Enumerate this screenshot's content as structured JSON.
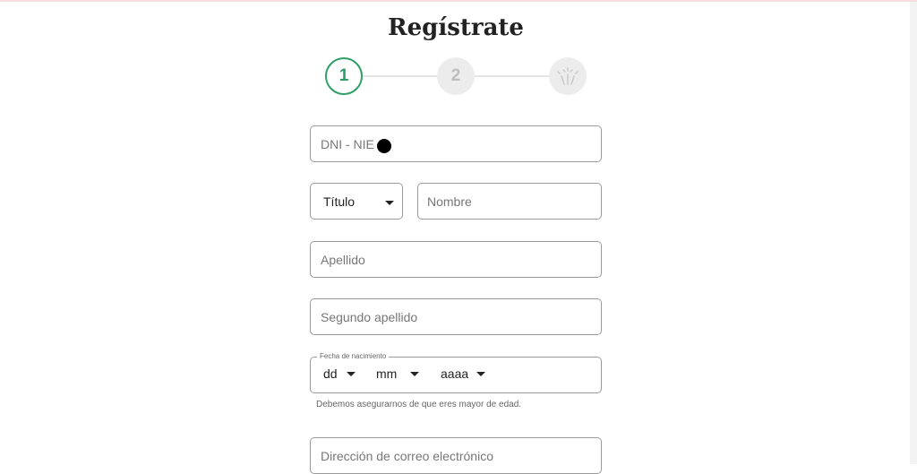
{
  "page": {
    "title": "Regístrate"
  },
  "stepper": {
    "steps": [
      {
        "label": "1",
        "state": "active"
      },
      {
        "label": "2",
        "state": "inactive"
      },
      {
        "label": "",
        "icon": "fireworks-icon",
        "state": "inactive"
      }
    ],
    "active_color": "#2f9e66"
  },
  "form": {
    "dni": {
      "placeholder": "DNI - NIE"
    },
    "title_select": {
      "value": "Título"
    },
    "nombre": {
      "placeholder": "Nombre"
    },
    "apellido": {
      "placeholder": "Apellido"
    },
    "segundo_apellido": {
      "placeholder": "Segundo apellido"
    },
    "fecha": {
      "legend": "Fecha de nacimiento",
      "day": "dd",
      "month": "mm",
      "year": "aaaa",
      "helper": "Debemos asegurarnos de que eres mayor de edad."
    },
    "email": {
      "placeholder": "Dirección de correo electrónico"
    }
  }
}
